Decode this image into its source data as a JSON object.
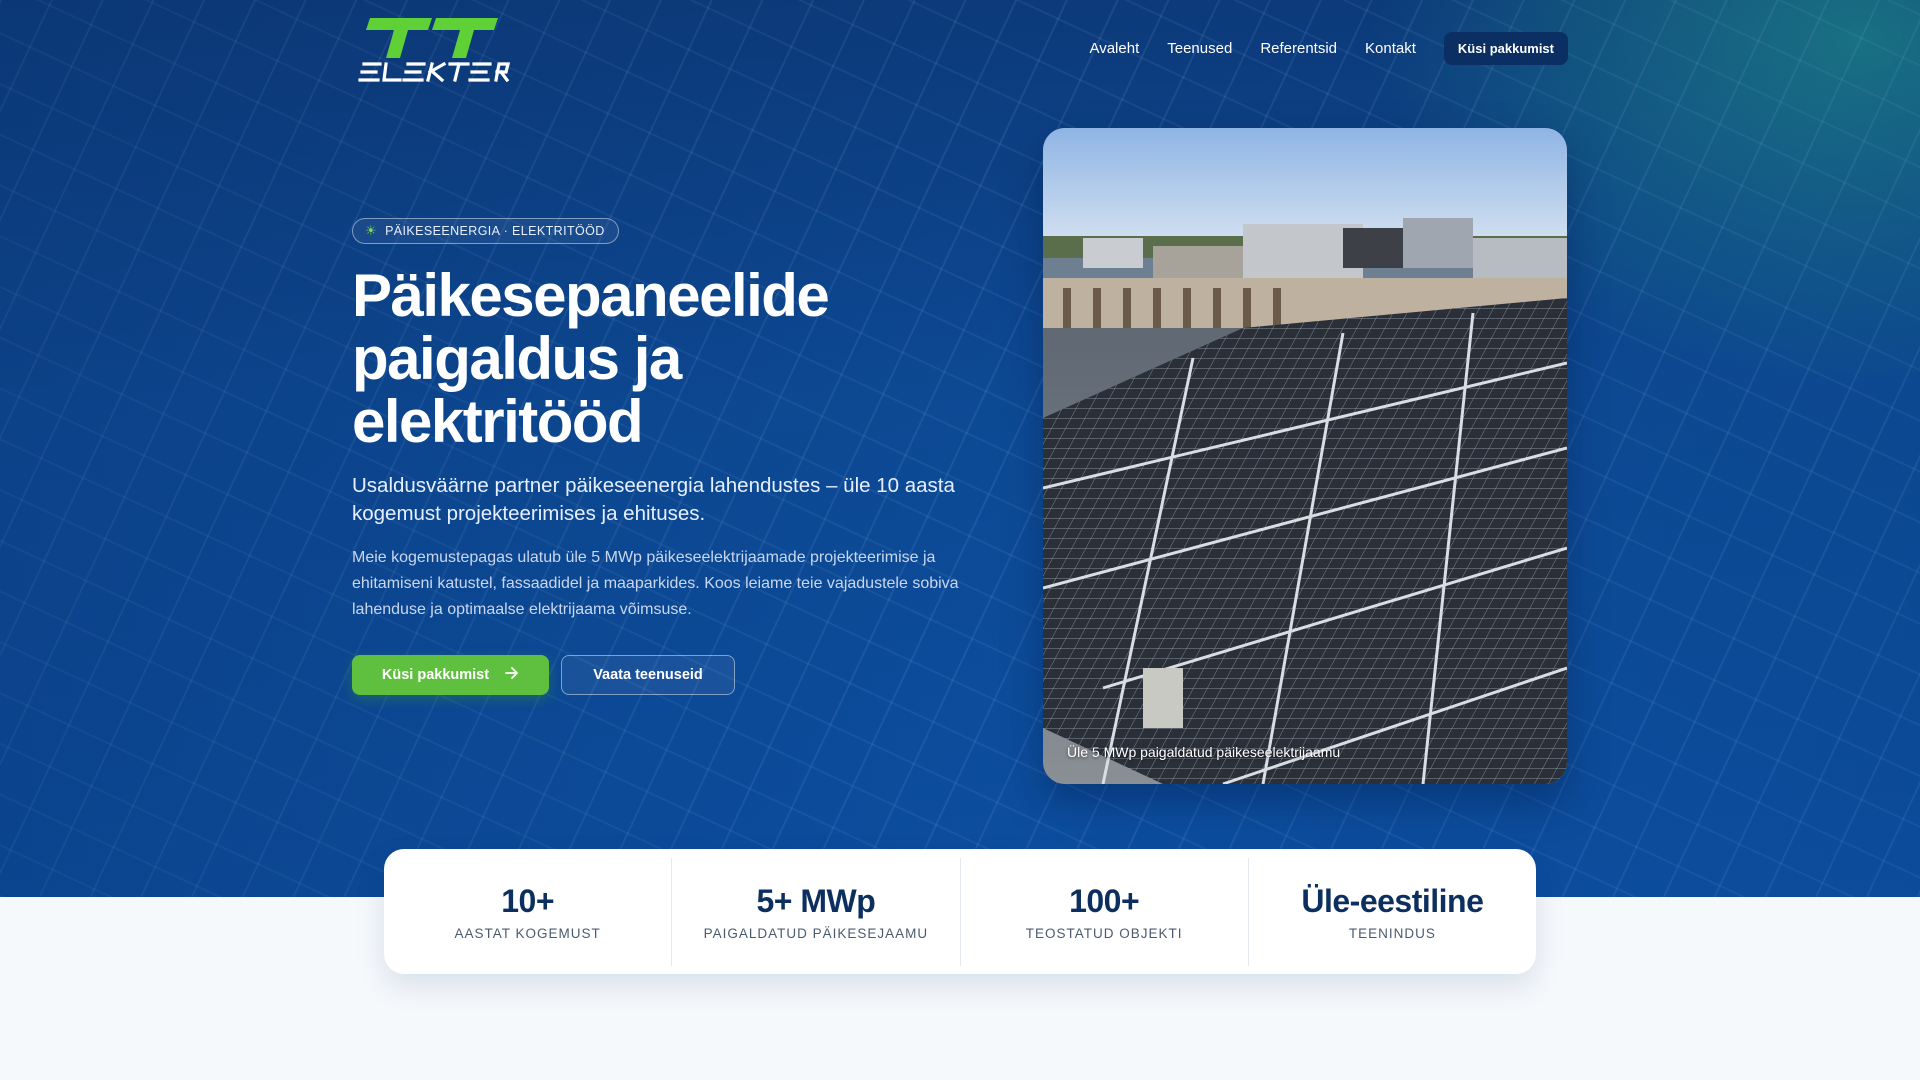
{
  "brand": {
    "logo_text": "TT ELEKTER",
    "logo_color": "#5fd136"
  },
  "nav": {
    "items": [
      "Avaleht",
      "Teenused",
      "Referentsid",
      "Kontakt"
    ],
    "cta": "Küsi pakkumist"
  },
  "hero": {
    "badge_icon": "sun-icon",
    "badge": "PÄIKESEENERGIA · ELEKTRITÖÖD",
    "title": "Päikesepaneelide paigaldus ja elektritööd",
    "lead": "Usaldusväärne partner päikeseenergia lahendustes – üle 10 aasta kogemust projekteerimises ja ehituses.",
    "body": "Meie kogemustepagas ulatub üle 5 MWp päikeseelektrijaamade projekteerimise ja ehitamiseni katustel, fassaadidel ja maaparkides. Koos leiame teie vajadustele sobiva lahenduse ja optimaalse elektrijaama võimsuse.",
    "primary_button": "Küsi pakkumist",
    "secondary_button": "Vaata teenuseid",
    "photo_caption": "Üle 5 MWp paigaldatud päikeseelektrijaamu"
  },
  "stats": [
    {
      "value": "10+",
      "label": "AASTAT KOGEMUST"
    },
    {
      "value": "5+ MWp",
      "label": "PAIGALDATUD PÄIKESEJAAMU"
    },
    {
      "value": "100+",
      "label": "TEOSTATUD OBJEKTI"
    },
    {
      "value": "Üle-eestiline",
      "label": "TEENINDUS"
    }
  ],
  "colors": {
    "primary_blue": "#0c4ea0",
    "accent_green": "#5fbf3f",
    "stat_text": "#0c2f5f"
  }
}
